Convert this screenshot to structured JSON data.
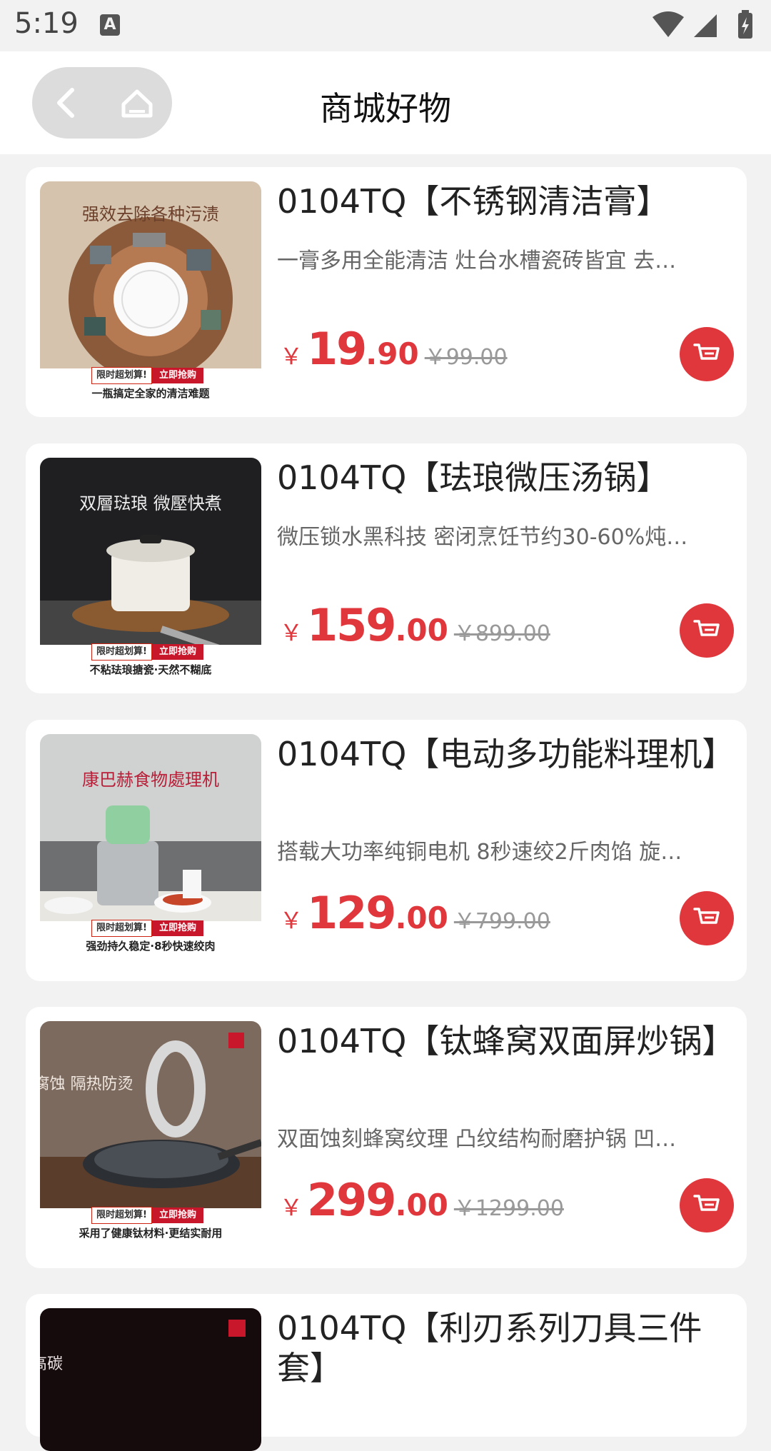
{
  "status_bar": {
    "time": "5:19",
    "notification_icon": "a-icon"
  },
  "header": {
    "title": "商城好物",
    "back_icon": "chevron-left-icon",
    "home_icon": "home-icon"
  },
  "colors": {
    "accent": "#e0373d",
    "background": "#f2f2f2",
    "card": "#ffffff"
  },
  "products": [
    {
      "title": "0104TQ【不锈钢清洁膏】",
      "desc": "一膏多用全能清洁 灶台水槽瓷砖皆宜 去…",
      "currency": "￥",
      "price_int": "19",
      "price_dec": ".90",
      "orig_price": "￥99.00",
      "image": {
        "headline": "强效去除各种污渍",
        "tag_left": "限时超划算!",
        "tag_right": "立即抢购",
        "caption": "一瓶搞定全家的清洁难题"
      }
    },
    {
      "title": "0104TQ【珐琅微压汤锅】",
      "desc": "微压锁水黑科技 密闭烹饪节约30-60%炖…",
      "currency": "￥",
      "price_int": "159",
      "price_dec": ".00",
      "orig_price": "￥899.00",
      "image": {
        "headline": "双層琺琅 微壓快煮",
        "tag_left": "限时超划算!",
        "tag_right": "立即抢购",
        "caption": "不粘珐琅搪瓷·天然不糊底"
      }
    },
    {
      "title": "0104TQ【电动多功能料理机】",
      "desc": "搭载大功率纯铜电机 8秒速绞2斤肉馅 旋…",
      "currency": "￥",
      "price_int": "129",
      "price_dec": ".00",
      "orig_price": "￥799.00",
      "image": {
        "headline": "康巴赫食物處理机",
        "tag_left": "限时超划算!",
        "tag_right": "立即抢购",
        "caption": "强劲持久稳定·8秒快速绞肉"
      }
    },
    {
      "title": "0104TQ【钛蜂窝双面屏炒锅】",
      "desc": "双面蚀刻蜂窝纹理 凸纹结构耐磨护锅 凹…",
      "currency": "￥",
      "price_int": "299",
      "price_dec": ".00",
      "orig_price": "￥1299.00",
      "image": {
        "headline": "抗腐蚀 隔热防烫",
        "tag_left": "限时超划算!",
        "tag_right": "立即抢购",
        "caption": "采用了健康钛材料·更结实耐用"
      }
    },
    {
      "title": "0104TQ【利刃系列刀具三件套】",
      "image": {
        "headline": "高碳"
      }
    }
  ]
}
